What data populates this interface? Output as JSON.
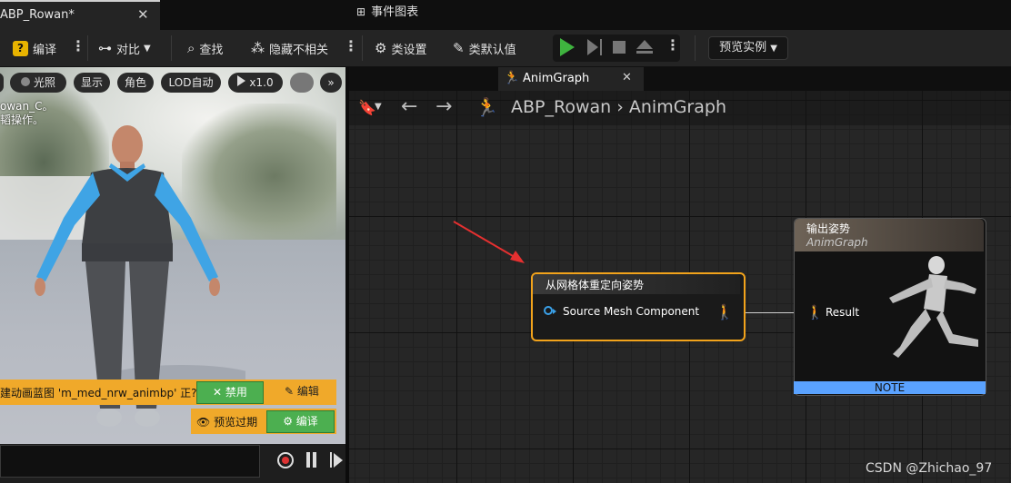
{
  "document_tab": {
    "title": "ABP_Rowan*",
    "close": "✕"
  },
  "toolbar": {
    "compile": "编译",
    "diff": "对比",
    "find": "查找",
    "hide_unrelated": "隐藏不相关",
    "class_settings": "类设置",
    "class_defaults": "类默认值",
    "preview_instance": "预览实例"
  },
  "viewport": {
    "buttons": [
      "光照",
      "显示",
      "角色",
      "LOD自动",
      "x1.0"
    ],
    "overlay_line1": "owan_C。",
    "overlay_line2": "韬操作。",
    "warning_text": "建动画蓝图 'm_med_nrw_animbp' 正?",
    "disable_label": "禁用",
    "edit_label": "编辑",
    "preview_expired": "预览过期",
    "compile_label": "编译"
  },
  "graph_tabs": {
    "event_graph": "事件图表",
    "anim_graph": "AnimGraph",
    "close": "✕"
  },
  "breadcrumb": {
    "blueprint": "ABP_Rowan",
    "graph": "AnimGraph"
  },
  "node": {
    "title": "从网格体重定向姿势",
    "pin": "Source Mesh Component"
  },
  "result_node": {
    "title": "输出姿势",
    "subtitle": "AnimGraph",
    "pin": "Result",
    "note": "NOTE"
  },
  "watermark": "CSDN @Zhichao_97",
  "colors": {
    "node_border": "#f2a31b",
    "note_bar": "#5aa2ff",
    "play_green": "#3fb33f",
    "warn_yellow": "#f0a92a"
  }
}
